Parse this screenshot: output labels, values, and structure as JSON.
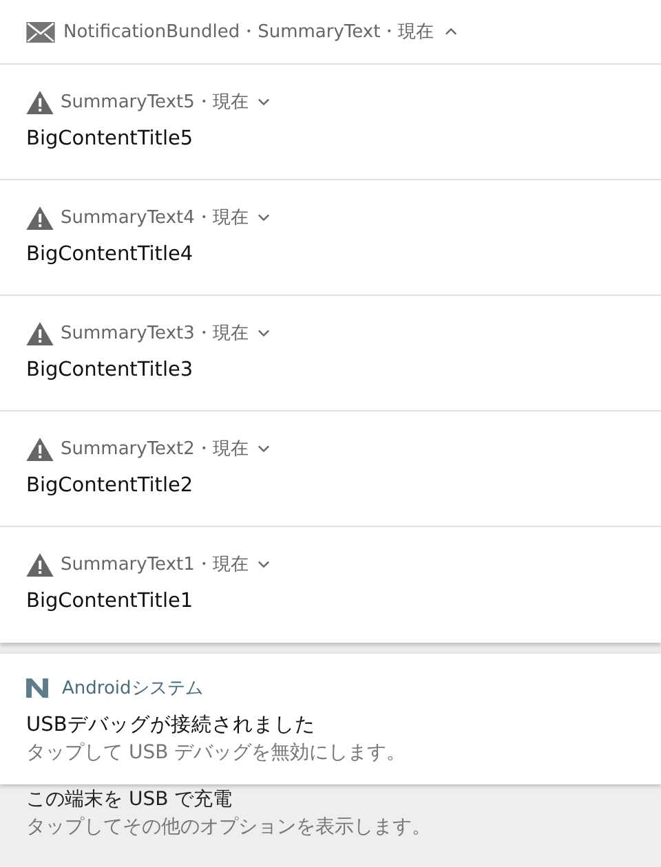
{
  "group": {
    "app": "NotificationBundled",
    "summary": "SummaryText",
    "time": "現在",
    "separator": "・",
    "expanded": true
  },
  "notifications": [
    {
      "summary": "SummaryText5",
      "time": "現在",
      "expanded": false,
      "title": "BigContentTitle5"
    },
    {
      "summary": "SummaryText4",
      "time": "現在",
      "expanded": false,
      "title": "BigContentTitle4"
    },
    {
      "summary": "SummaryText3",
      "time": "現在",
      "expanded": false,
      "title": "BigContentTitle3"
    },
    {
      "summary": "SummaryText2",
      "time": "現在",
      "expanded": false,
      "title": "BigContentTitle2"
    },
    {
      "summary": "SummaryText1",
      "time": "現在",
      "expanded": false,
      "title": "BigContentTitle1"
    }
  ],
  "system": {
    "app": "Androidシステム",
    "title": "USBデバッグが接続されました",
    "text": "タップして USB デバッグを無効にします。"
  },
  "below": {
    "title": "この端末を USB で充電",
    "text": "タップしてその他のオプションを表示します。"
  }
}
